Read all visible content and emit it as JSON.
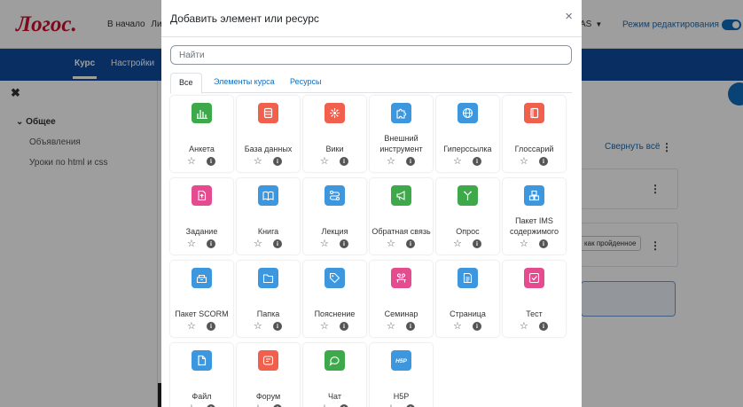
{
  "site": {
    "logo": "Логос.",
    "nav_home": "В начало",
    "nav_partial": "Ли",
    "lang": "AS",
    "edit_mode": "Режим редактирования"
  },
  "course_nav": {
    "course": "Курс",
    "settings": "Настройки"
  },
  "sidebar": {
    "section": "Общее",
    "items": [
      "Объявления",
      "Уроки по html и css"
    ]
  },
  "main": {
    "collapse_all": "Свернуть всё",
    "mark_done": "как пройденное"
  },
  "modal": {
    "title": "Добавить элемент или ресурс",
    "close": "×",
    "search_placeholder": "Найти",
    "tabs": [
      "Все",
      "Элементы курса",
      "Ресурсы"
    ]
  },
  "colors": {
    "green": "#3da94a",
    "red": "#f0604d",
    "blue": "#3c97df",
    "pink": "#e54c8f",
    "nav_blue": "#0f4c9e"
  },
  "items": [
    {
      "name": "Анкета",
      "color": "green",
      "icon": "chart-icon"
    },
    {
      "name": "База данных",
      "color": "red",
      "icon": "database-icon"
    },
    {
      "name": "Вики",
      "color": "red",
      "icon": "wiki-icon"
    },
    {
      "name": "Внешний инструмент",
      "color": "blue",
      "icon": "puzzle-icon"
    },
    {
      "name": "Гиперссылка",
      "color": "blue",
      "icon": "globe-icon"
    },
    {
      "name": "Глоссарий",
      "color": "red",
      "icon": "book-closed-icon"
    },
    {
      "name": "Задание",
      "color": "pink",
      "icon": "file-upload-icon"
    },
    {
      "name": "Книга",
      "color": "blue",
      "icon": "open-book-icon"
    },
    {
      "name": "Лекция",
      "color": "blue",
      "icon": "lesson-path-icon"
    },
    {
      "name": "Обратная связь",
      "color": "green",
      "icon": "megaphone-icon"
    },
    {
      "name": "Опрос",
      "color": "green",
      "icon": "choice-icon"
    },
    {
      "name": "Пакет IMS содержимого",
      "color": "blue",
      "icon": "package-icon"
    },
    {
      "name": "Пакет SCORM",
      "color": "blue",
      "icon": "scorm-box-icon"
    },
    {
      "name": "Папка",
      "color": "blue",
      "icon": "folder-icon"
    },
    {
      "name": "Пояснение",
      "color": "blue",
      "icon": "tag-icon"
    },
    {
      "name": "Семинар",
      "color": "pink",
      "icon": "workshop-icon"
    },
    {
      "name": "Страница",
      "color": "blue",
      "icon": "page-icon"
    },
    {
      "name": "Тест",
      "color": "pink",
      "icon": "quiz-check-icon"
    },
    {
      "name": "Файл",
      "color": "blue",
      "icon": "file-icon"
    },
    {
      "name": "Форум",
      "color": "red",
      "icon": "forum-icon"
    },
    {
      "name": "Чат",
      "color": "green",
      "icon": "chat-icon"
    },
    {
      "name": "H5P",
      "color": "blue",
      "icon": "h5p-icon"
    }
  ]
}
